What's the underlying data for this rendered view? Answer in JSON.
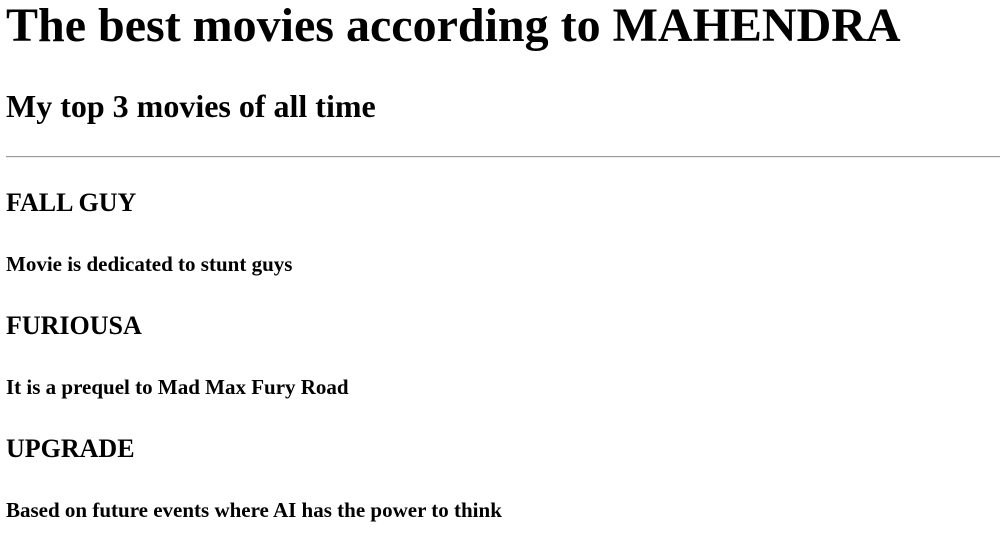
{
  "header": {
    "title": "The best movies according to MAHENDRA",
    "subtitle": "My top 3 movies of all time"
  },
  "movies": [
    {
      "title": "FALL GUY",
      "description": "Movie is dedicated to stunt guys"
    },
    {
      "title": "FURIOUSA",
      "description": "It is a prequel to Mad Max Fury Road"
    },
    {
      "title": "UPGRADE",
      "description": "Based on future events where AI has the power to think"
    }
  ]
}
